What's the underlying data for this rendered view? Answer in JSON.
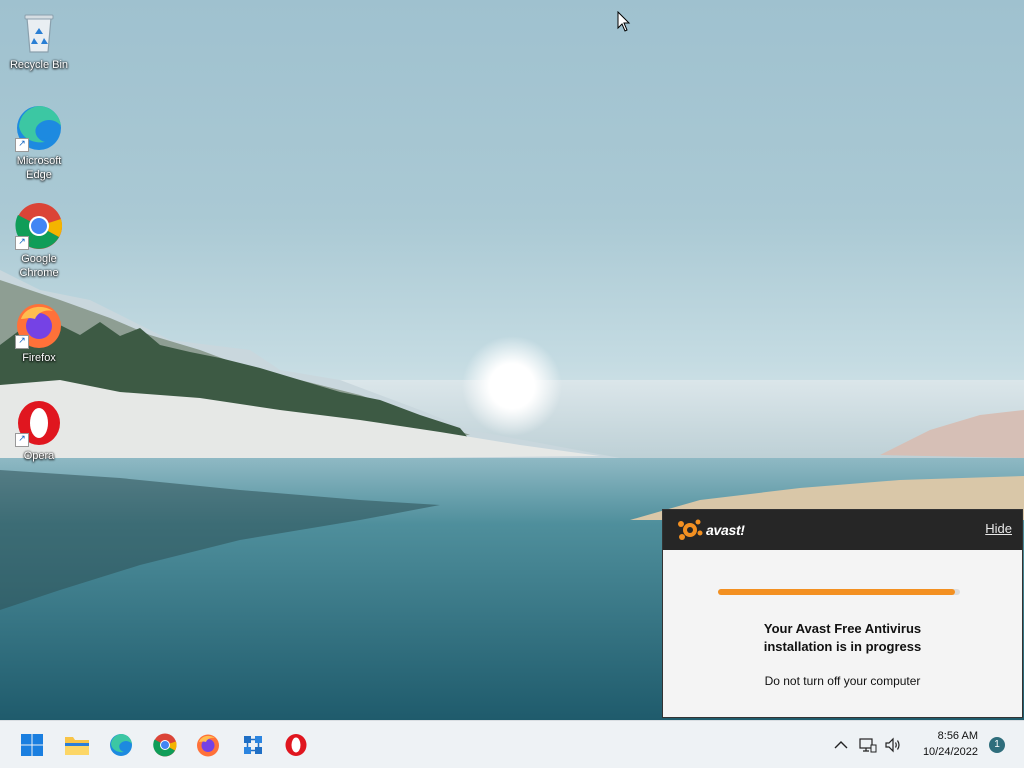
{
  "desktop": {
    "icons": [
      {
        "label": "Recycle Bin"
      },
      {
        "label": "Microsoft Edge"
      },
      {
        "label": "Google Chrome"
      },
      {
        "label": "Firefox"
      },
      {
        "label": "Opera"
      }
    ]
  },
  "avast_popup": {
    "logo_text": "avast!",
    "hide_label": "Hide",
    "progress_fraction": 0.98,
    "title_line1": "Your Avast Free Antivirus",
    "title_line2": "installation is in progress",
    "subtitle": "Do not turn off your computer",
    "accent_color": "#f39021"
  },
  "taskbar": {
    "apps": [
      {
        "icon": "windows-start-icon"
      },
      {
        "icon": "file-explorer-icon"
      },
      {
        "icon": "edge-icon"
      },
      {
        "icon": "chrome-icon"
      },
      {
        "icon": "firefox-icon"
      },
      {
        "icon": "network-app-icon"
      },
      {
        "icon": "opera-icon"
      }
    ],
    "tray": {
      "clock_time": "8:56 AM",
      "clock_date": "10/24/2022",
      "notification_count": "1"
    }
  }
}
